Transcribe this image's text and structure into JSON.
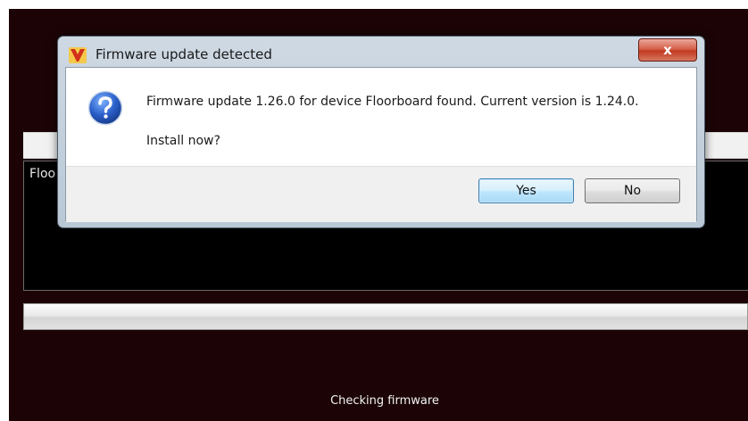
{
  "background_app": {
    "panel_label": "Floo",
    "status_text": "Checking firmware"
  },
  "dialog": {
    "title": "Firmware update detected",
    "close_label": "x",
    "message": "Firmware update 1.26.0 for device Floorboard found. Current version is 1.24.0.",
    "question": "Install now?",
    "buttons": {
      "yes": "Yes",
      "no": "No"
    }
  },
  "colors": {
    "app_background": "#1c0406",
    "close_button": "#c23a22",
    "default_button_border": "#3c7fb1"
  },
  "icons": {
    "app": "amp-logo-icon",
    "message": "question-icon",
    "close": "close-icon"
  }
}
